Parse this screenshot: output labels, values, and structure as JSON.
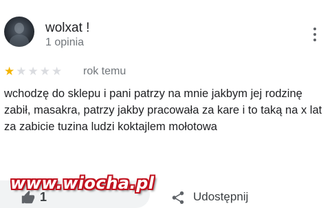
{
  "review": {
    "author": "wolxat !",
    "review_count": "1 opinia",
    "rating": 1,
    "rating_max": 5,
    "date": "rok temu",
    "text": "wchodzę do sklepu i pani patrzy na mnie jakbym jej rodzinę zabił, masakra, patrzy jakby pracowała za kare i to taką na x lat za zabicie tuzina ludzi koktajlem mołotowa"
  },
  "actions": {
    "like_count": "1",
    "share_label": "Udostępnij"
  },
  "watermark": "www.wiocha.pl",
  "icons": {
    "more": "more-vert-icon",
    "star": "star-icon",
    "like": "thumb-up-icon",
    "share": "share-icon"
  },
  "colors": {
    "star_filled": "#f4b400",
    "star_empty": "#dadce0",
    "watermark": "#c1121f"
  }
}
